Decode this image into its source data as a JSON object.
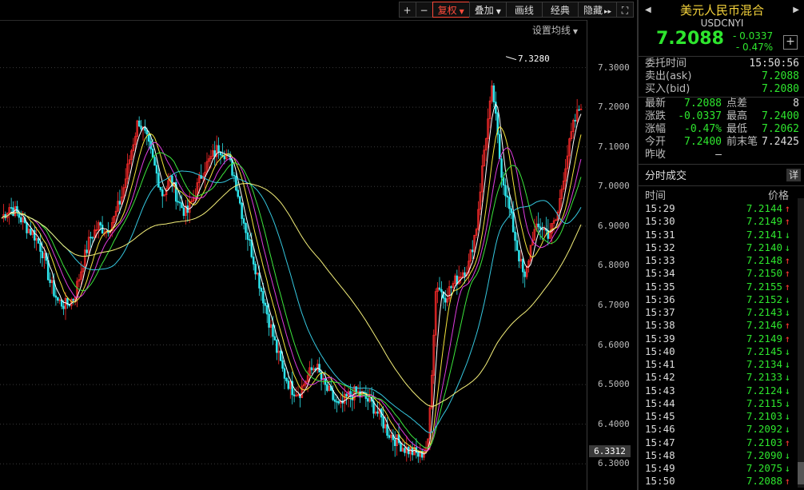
{
  "toolbar": {
    "zoom_in": "+",
    "zoom_out": "−",
    "adjust": "复权",
    "overlay": "叠加",
    "draw": "画线",
    "classic": "经典",
    "hide": "隐藏",
    "hide_arrow": "▸▸",
    "fullscreen": "⛶"
  },
  "chart": {
    "ma_setting": "设置均线",
    "peak_label": "7.3280",
    "current_price": "6.3312",
    "y_ticks": [
      "7.3000",
      "7.2000",
      "7.1000",
      "7.0000",
      "6.9000",
      "6.8000",
      "6.7000",
      "6.6000",
      "6.5000",
      "6.4000",
      "6.3000"
    ]
  },
  "chart_data": {
    "type": "line",
    "title": "",
    "ylim": [
      6.25,
      7.4
    ],
    "series": [
      {
        "values": [
          6.92,
          6.95,
          6.93,
          6.9,
          6.88,
          6.84,
          6.76,
          6.71,
          6.7,
          6.72,
          6.8,
          6.87,
          6.9,
          6.89,
          6.92,
          6.98,
          7.08,
          7.17,
          7.12,
          7.05,
          6.98,
          7.02,
          6.96,
          6.93,
          6.98,
          7.04,
          7.07,
          7.1,
          7.08,
          7.02,
          6.92,
          6.84,
          6.76,
          6.68,
          6.6,
          6.53,
          6.49,
          6.48,
          6.52,
          6.55,
          6.5,
          6.47,
          6.44,
          6.47,
          6.48,
          6.47,
          6.45,
          6.42,
          6.38,
          6.36,
          6.34,
          6.33,
          6.32,
          6.35,
          6.76,
          6.72,
          6.75,
          6.78,
          6.8,
          6.9,
          7.1,
          7.25,
          7.05,
          6.95,
          6.85,
          6.76,
          6.88,
          6.9,
          6.88,
          6.92,
          7.05,
          7.15,
          7.21
        ]
      }
    ],
    "grid": true,
    "colors": {
      "candle_up": "#ff2b2b",
      "candle_down": "#2ee6ee",
      "ma_short": "#ffffff",
      "ma_mid": "#f5e63c",
      "ma_long": "#35c8e0",
      "ma_green": "#3ce63c",
      "ma_magenta": "#e03ce0",
      "ma_yellow_long": "#f5f07a"
    }
  },
  "side": {
    "title": "美元人民币混合",
    "code": "USDCNYI",
    "last": "7.2088",
    "change": "- 0.0337",
    "change_pct": "- 0.47%",
    "plus": "+",
    "order_time_label": "委托时间",
    "order_time": "15:50:56",
    "ask_label": "卖出(ask)",
    "ask": "7.2088",
    "bid_label": "买入(bid)",
    "bid": "7.2080",
    "quotes": {
      "latest_label": "最新",
      "latest": "7.2088",
      "spread_label": "点差",
      "spread": "8",
      "chg_label": "涨跌",
      "chg": "-0.0337",
      "high_label": "最高",
      "high": "7.2400",
      "pct_label": "涨幅",
      "pct": "-0.47%",
      "low_label": "最低",
      "low": "7.2062",
      "open_label": "今开",
      "open": "7.2400",
      "prev_last_label": "前末笔",
      "prev_last": "7.2425",
      "prev_close_label": "昨收",
      "prev_close": "—"
    },
    "trades_title": "分时成交",
    "detail": "详",
    "col_time": "时间",
    "col_price": "价格",
    "trades": [
      {
        "time": "15:29",
        "price": "7.2144",
        "dir": "↑"
      },
      {
        "time": "15:30",
        "price": "7.2149",
        "dir": "↑"
      },
      {
        "time": "15:31",
        "price": "7.2141",
        "dir": "↓"
      },
      {
        "time": "15:32",
        "price": "7.2140",
        "dir": "↓"
      },
      {
        "time": "15:33",
        "price": "7.2148",
        "dir": "↑"
      },
      {
        "time": "15:34",
        "price": "7.2150",
        "dir": "↑"
      },
      {
        "time": "15:35",
        "price": "7.2155",
        "dir": "↑"
      },
      {
        "time": "15:36",
        "price": "7.2152",
        "dir": "↓"
      },
      {
        "time": "15:37",
        "price": "7.2143",
        "dir": "↓"
      },
      {
        "time": "15:38",
        "price": "7.2146",
        "dir": "↑"
      },
      {
        "time": "15:39",
        "price": "7.2149",
        "dir": "↑"
      },
      {
        "time": "15:40",
        "price": "7.2145",
        "dir": "↓"
      },
      {
        "time": "15:41",
        "price": "7.2134",
        "dir": "↓"
      },
      {
        "time": "15:42",
        "price": "7.2133",
        "dir": "↓"
      },
      {
        "time": "15:43",
        "price": "7.2124",
        "dir": "↓"
      },
      {
        "time": "15:44",
        "price": "7.2115",
        "dir": "↓"
      },
      {
        "time": "15:45",
        "price": "7.2103",
        "dir": "↓"
      },
      {
        "time": "15:46",
        "price": "7.2092",
        "dir": "↓"
      },
      {
        "time": "15:47",
        "price": "7.2103",
        "dir": "↑"
      },
      {
        "time": "15:48",
        "price": "7.2090",
        "dir": "↓"
      },
      {
        "time": "15:49",
        "price": "7.2075",
        "dir": "↓"
      },
      {
        "time": "15:50",
        "price": "7.2088",
        "dir": "↑"
      }
    ]
  }
}
